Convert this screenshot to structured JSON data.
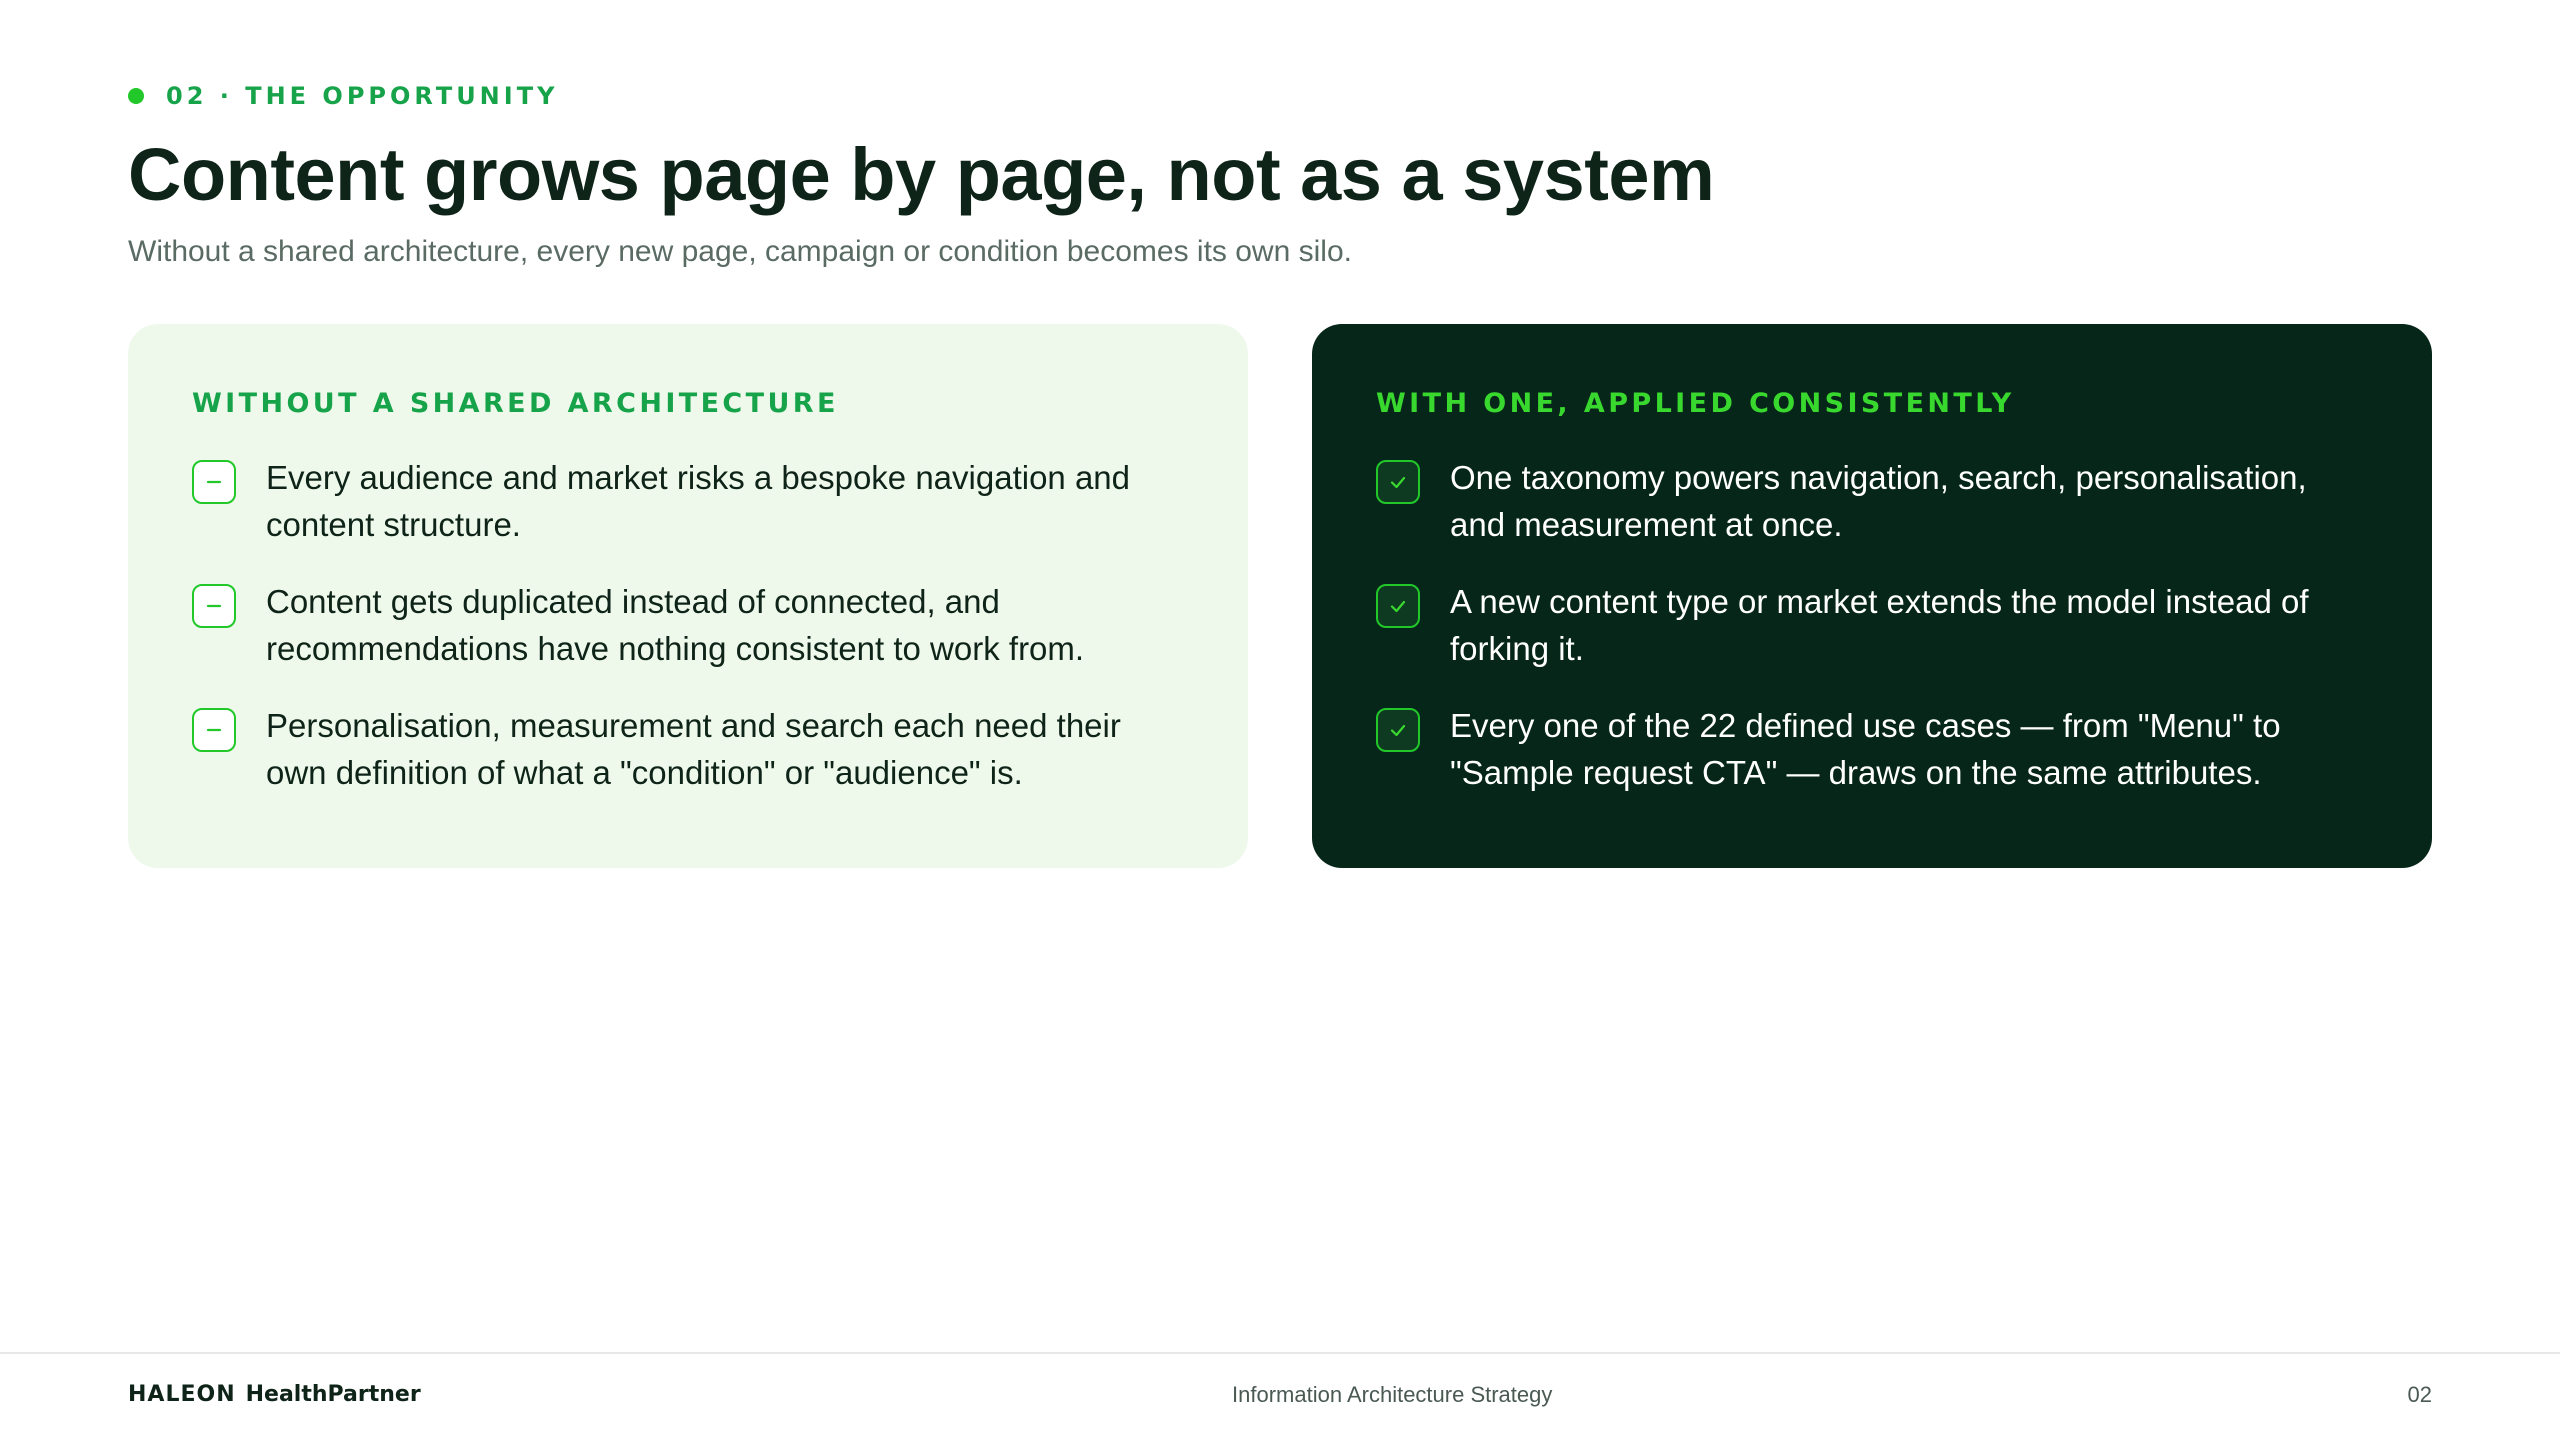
{
  "eyebrow": {
    "label": "02 · THE OPPORTUNITY"
  },
  "title": "Content grows page by page, not as a system",
  "subtitle": "Without a shared architecture, every new page, campaign or condition becomes its own silo.",
  "colors": {
    "accent": "#22c82a",
    "accent_text": "#16a34a",
    "dark_panel": "#062619",
    "light_panel": "#eef9eb",
    "ink": "#0f2418"
  },
  "cards": {
    "without": {
      "heading": "WITHOUT A SHARED ARCHITECTURE",
      "icon": "minus-icon",
      "items": [
        {
          "text": "Every audience and market risks a bespoke navigation and content structure."
        },
        {
          "text": "Content gets duplicated instead of connected, and recommendations have nothing consistent to work from."
        },
        {
          "text": "Personalisation, measurement and search each need their own definition of what a \"condition\" or \"audience\" is."
        }
      ]
    },
    "with": {
      "heading": "WITH ONE, APPLIED CONSISTENTLY",
      "icon": "check-icon",
      "items": [
        {
          "text": "One taxonomy powers navigation, search, personalisation, and measurement at once."
        },
        {
          "text": "A new content type or market extends the model instead of forking it."
        },
        {
          "text": "Every one of the 22 defined use cases — from \"Menu\" to \"Sample request CTA\" — draws on the same attributes."
        }
      ]
    }
  },
  "footer": {
    "logo_brand": "HALEON",
    "logo_product": "HealthPartner",
    "center_text": "Information Architecture Strategy",
    "page_number": "02"
  }
}
